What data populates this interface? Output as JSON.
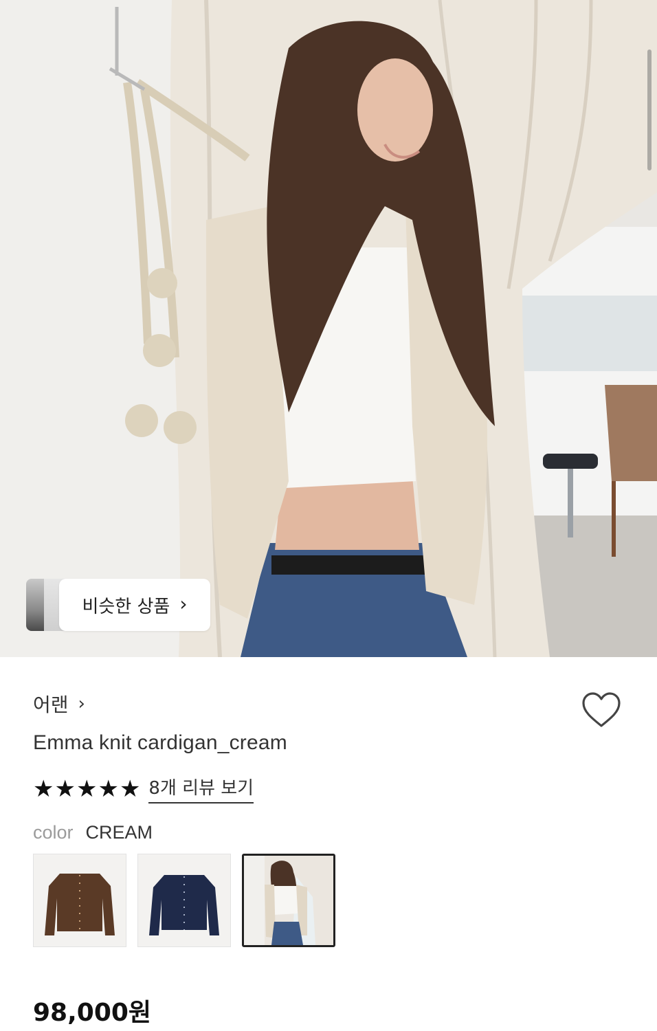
{
  "similar_products": {
    "label": "비슷한 상품",
    "chevron": "›"
  },
  "product": {
    "brand": "어랜",
    "brand_chevron": "›",
    "title": "Emma knit cardigan_cream",
    "rating": {
      "stars": 5,
      "review_link": "8개 리뷰 보기"
    },
    "color": {
      "label": "color",
      "value": "CREAM"
    },
    "swatches": [
      {
        "name": "brown",
        "color": "#5a3a26"
      },
      {
        "name": "navy",
        "color": "#1f2a4a"
      },
      {
        "name": "cream",
        "color": "#ede6d8",
        "selected": true
      }
    ],
    "price": "98,000원"
  },
  "icons": {
    "wishlist": "heart-outline-icon",
    "star": "star-filled-icon"
  }
}
